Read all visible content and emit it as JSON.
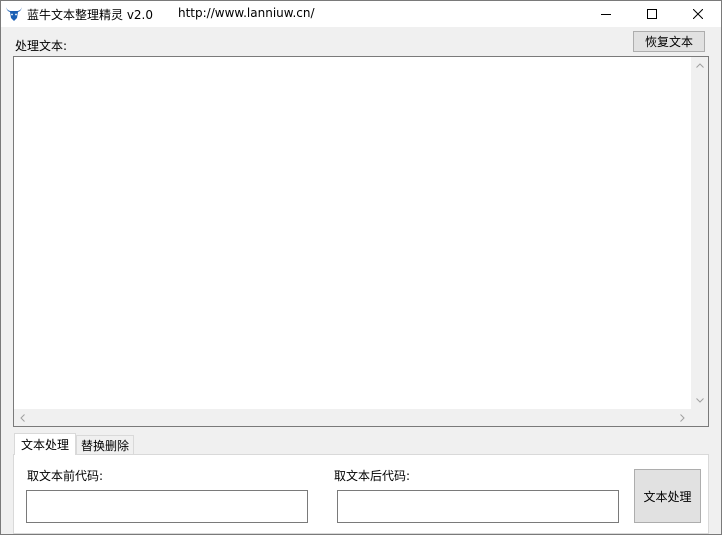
{
  "window": {
    "title": "蓝牛文本整理精灵 v2.0",
    "url": "http://www.lanniuw.cn/",
    "icon": "bull-logo-icon",
    "accent_color": "#1a5fb4"
  },
  "main": {
    "process_text_label": "处理文本:",
    "restore_button": "恢复文本",
    "text_value": ""
  },
  "tabs": [
    {
      "label": "文本处理",
      "active": true
    },
    {
      "label": "替换删除",
      "active": false
    }
  ],
  "tab_panel": {
    "pre_code_label": "取文本前代码:",
    "post_code_label": "取文本后代码:",
    "pre_code_value": "",
    "post_code_value": "",
    "process_button": "文本处理"
  }
}
